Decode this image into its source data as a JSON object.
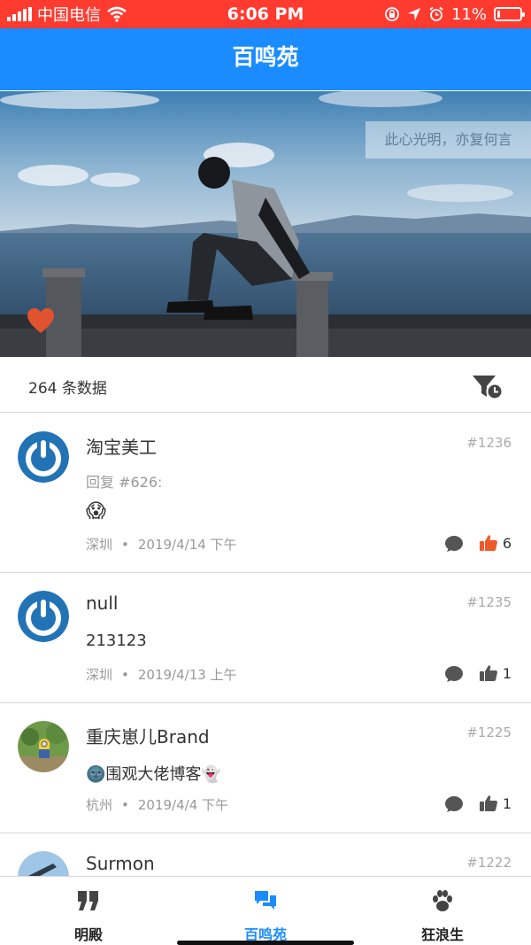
{
  "status_bar": {
    "carrier": "中国电信",
    "time": "6:06 PM",
    "battery": "11%",
    "battery_level": 0.11,
    "icons": [
      "signal-icon",
      "wifi-icon",
      "lock-rotation-icon",
      "location-icon",
      "alarm-icon",
      "battery-icon"
    ]
  },
  "header": {
    "title": "百鸣苑"
  },
  "banner": {
    "quote": "此心光明，亦复何言",
    "icon": "heart-icon"
  },
  "list_header": {
    "count_text": "264 条数据",
    "filter_icon": "filter-clock-icon"
  },
  "posts": [
    {
      "author": "淘宝美工",
      "id": "#1236",
      "reply": "回复 #626:",
      "content": "😱",
      "location": "深圳",
      "date": "2019/4/14 下午",
      "likes": "6",
      "liked": true,
      "avatar": "power-avatar"
    },
    {
      "author": "null",
      "id": "#1235",
      "content": "213123",
      "location": "深圳",
      "date": "2019/4/13 上午",
      "likes": "1",
      "liked": false,
      "avatar": "power-avatar"
    },
    {
      "author": "重庆崽儿Brand",
      "id": "#1225",
      "content": "🌚围观大佬博客👻",
      "location": "杭州",
      "date": "2019/4/4 下午",
      "likes": "1",
      "liked": false,
      "avatar": "minion-photo-avatar"
    },
    {
      "author": "Surmon",
      "id": "#1222",
      "avatar": "photo-avatar"
    }
  ],
  "meta_separator": "•",
  "tabs": [
    {
      "label": "明殿",
      "icon": "quote-icon",
      "active": false
    },
    {
      "label": "百鸣苑",
      "icon": "chat-bubbles-icon",
      "active": true
    },
    {
      "label": "狂浪生",
      "icon": "paw-icon",
      "active": false
    }
  ],
  "colors": {
    "status_bar": "#ff3b30",
    "primary": "#1a8cff",
    "like_active": "#ef5a2a",
    "heart": "#e0532e"
  }
}
